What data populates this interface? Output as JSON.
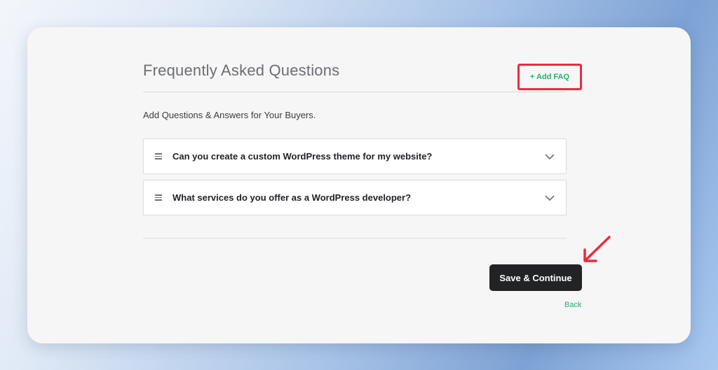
{
  "header": {
    "title": "Frequently Asked Questions",
    "add_faq_label": "+ Add FAQ"
  },
  "subtitle": "Add Questions & Answers for Your Buyers.",
  "faqs": [
    {
      "question": "Can you create a custom WordPress theme for my website?",
      "icon": "chevron-down-icon"
    },
    {
      "question": "What services do you offer as a WordPress developer?",
      "icon": "chevron-down-icon"
    }
  ],
  "footer": {
    "save_label": "Save & Continue",
    "back_label": "Back"
  },
  "colors": {
    "accent_green": "#23b26d",
    "highlight_red": "#ee2a3d",
    "button_dark": "#222325"
  }
}
